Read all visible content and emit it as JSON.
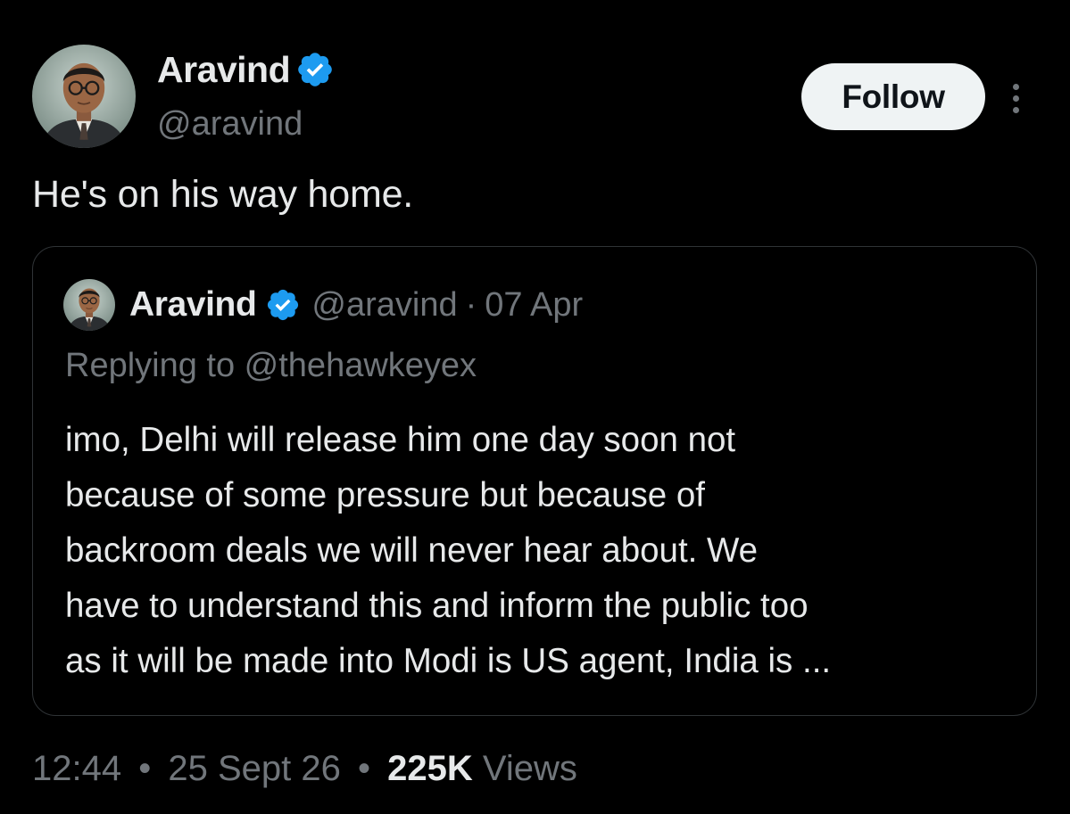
{
  "tweet": {
    "author": {
      "display_name": "Aravind",
      "handle": "@aravind",
      "verified": true
    },
    "follow_label": "Follow",
    "text": "He's on his way home.",
    "quoted": {
      "display_name": "Aravind",
      "handle": "@aravind",
      "separator": "·",
      "date": "07 Apr",
      "replying_to": "Replying to @thehawkeyex",
      "body_lines": [
        "imo, Delhi will release him one day soon not",
        "because of some pressure but because of",
        "backroom deals we will never hear about. We",
        "have to understand this and inform the public too",
        "as it will be made into Modi is US agent, India is ..."
      ]
    },
    "footer": {
      "time": "12:44",
      "dot": "•",
      "date": "25 Sept 26",
      "views_count": "225K",
      "views_label": "Views"
    }
  },
  "colors": {
    "background": "#000000",
    "text_primary": "#e7e9ea",
    "text_secondary": "#71767b",
    "verified_blue": "#1d9bf0",
    "follow_bg": "#eff3f4",
    "border": "#2f3336"
  },
  "icons": {
    "verified": "verified-badge-icon",
    "more": "more-options-icon"
  }
}
